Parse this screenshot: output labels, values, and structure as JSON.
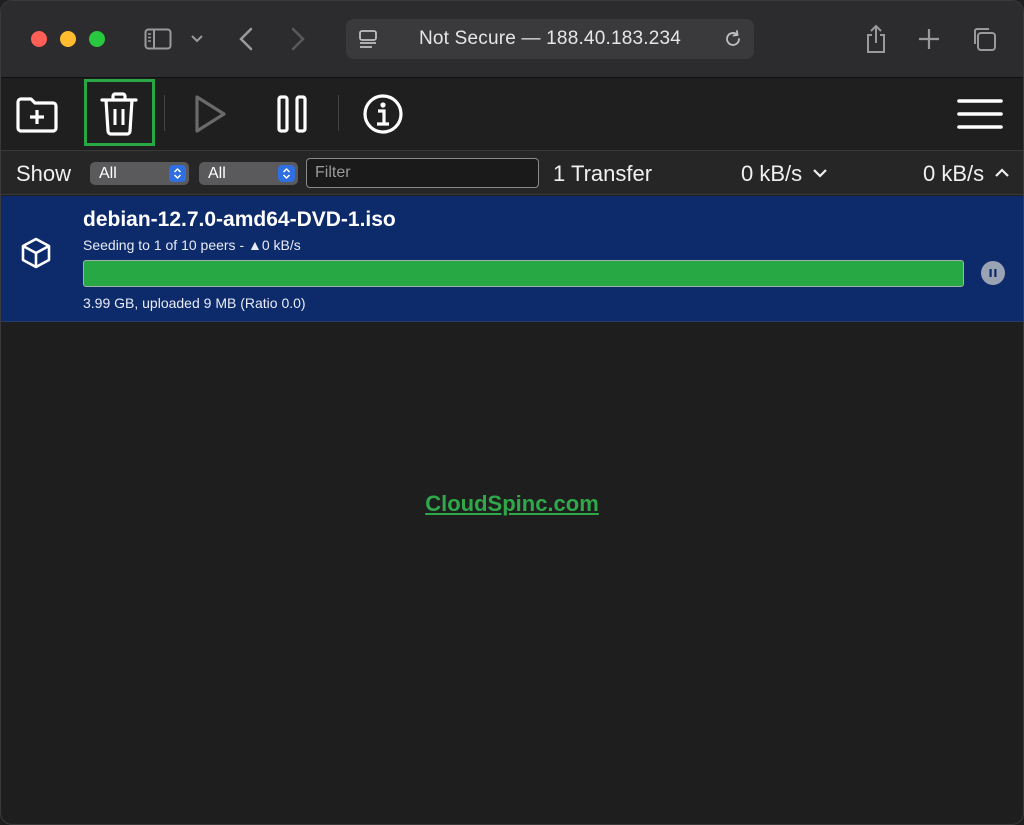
{
  "browser": {
    "address": "Not Secure — 188.40.183.234"
  },
  "icons": {
    "sidebar": "sidebar-icon",
    "back": "chevron-left-icon",
    "forward": "chevron-right-icon",
    "reload": "reload-icon",
    "share": "share-icon",
    "new_tab": "plus-icon",
    "tabs": "tab-overview-icon",
    "open": "folder-plus-icon",
    "remove": "trash-icon",
    "start": "play-icon",
    "pause": "pause-icon",
    "info": "info-icon",
    "menu": "hamburger-menu-icon"
  },
  "filterbar": {
    "show_label": "Show",
    "filter1": "All",
    "filter2": "All",
    "filter_placeholder": "Filter",
    "transfer_count": "1 Transfer",
    "download_speed": "0 kB/s",
    "upload_speed": "0 kB/s"
  },
  "torrent": {
    "name": "debian-12.7.0-amd64-DVD-1.iso",
    "peers": "Seeding to 1 of 10 peers - ▲0 kB/s",
    "stats": "3.99 GB, uploaded 9 MB (Ratio 0.0)",
    "progress_percent": 100
  },
  "watermark": "CloudSpinc.com",
  "colors": {
    "row_selected": "#0d2a6b",
    "progress": "#28a745",
    "highlight": "#29a745",
    "watermark": "#2fa84a"
  }
}
